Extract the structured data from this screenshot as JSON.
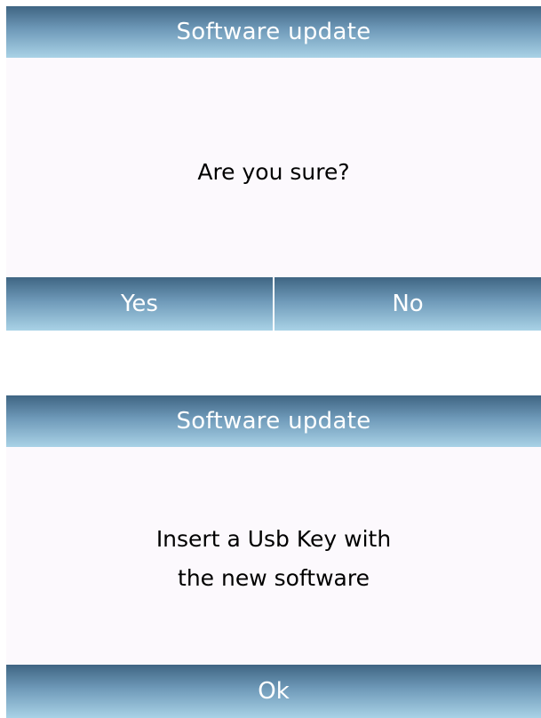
{
  "confirm_dialog": {
    "title": "Software update",
    "message": "Are you sure?",
    "yes_label": "Yes",
    "no_label": "No"
  },
  "insert_dialog": {
    "title": "Software update",
    "message_line1": "Insert a Usb Key with",
    "message_line2": "the new software",
    "ok_label": "Ok"
  },
  "colors": {
    "bar_top": "#3f6583",
    "bar_bottom": "#a9d2e6",
    "panel_bg": "#fcf9fd"
  }
}
